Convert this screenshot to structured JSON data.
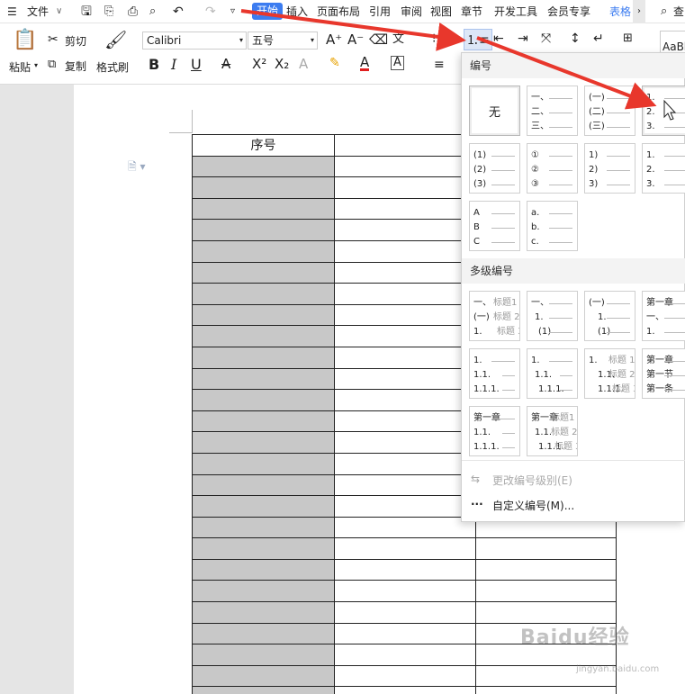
{
  "toolbar": {
    "menu_label": "文件",
    "tabs": [
      "开始",
      "插入",
      "页面布局",
      "引用",
      "审阅",
      "视图",
      "章节",
      "开发工具",
      "会员专享",
      "表格"
    ],
    "active_tab": "开始",
    "search_label": "查"
  },
  "ribbon": {
    "paste": "粘贴",
    "cut": "剪切",
    "copy": "复制",
    "format_painter": "格式刷",
    "font": "Calibri",
    "size": "五号",
    "style_preview": "AaBl"
  },
  "table": {
    "header": "序号",
    "rows": 26
  },
  "dropdown": {
    "section_numbering": "编号",
    "section_multilevel": "多级编号",
    "none_label": "无",
    "change_level": "更改编号级别(E)",
    "custom": "自定义编号(M)...",
    "cards_row1": [
      [
        "一、",
        "二、",
        "三、"
      ],
      [
        "(一)",
        "(二)",
        "(三)"
      ],
      [
        "1.",
        "2.",
        "3."
      ]
    ],
    "cards_row2": [
      [
        "(1)",
        "(2)",
        "(3)"
      ],
      [
        "①",
        "②",
        "③"
      ],
      [
        "1)",
        "2)",
        "3)"
      ],
      [
        "1.",
        "2.",
        "3."
      ]
    ],
    "cards_row3": [
      [
        "A",
        "B",
        "C"
      ],
      [
        "a.",
        "b.",
        "c."
      ]
    ],
    "multi_row1": [
      [
        [
          "一、",
          "标题1"
        ],
        [
          "(一)",
          "标题 2"
        ],
        [
          "1.",
          "标题 3"
        ]
      ],
      [
        [
          "一、",
          ""
        ],
        [
          "1.",
          ""
        ],
        [
          "(1)",
          ""
        ]
      ],
      [
        [
          "(一)",
          ""
        ],
        [
          "1.",
          ""
        ],
        [
          "(1)",
          ""
        ]
      ],
      [
        [
          "第一章",
          ""
        ],
        [
          "一、",
          ""
        ],
        [
          "1.",
          ""
        ]
      ]
    ],
    "multi_row2": [
      [
        [
          "1.",
          ""
        ],
        [
          "1.1.",
          ""
        ],
        [
          "1.1.1.",
          ""
        ]
      ],
      [
        [
          "1.",
          ""
        ],
        [
          "1.1.",
          ""
        ],
        [
          "1.1.1.",
          ""
        ]
      ],
      [
        [
          "1.",
          "标题 1"
        ],
        [
          "1.1.",
          "标题 2"
        ],
        [
          "1.1.1.",
          "标题 3"
        ]
      ],
      [
        [
          "第一章",
          ""
        ],
        [
          "第一节",
          ""
        ],
        [
          "第一条",
          ""
        ]
      ]
    ],
    "multi_row3": [
      [
        [
          "第一章",
          ""
        ],
        [
          "1.1.",
          ""
        ],
        [
          "1.1.1.",
          ""
        ]
      ],
      [
        [
          "第一章",
          "标题1"
        ],
        [
          "1.1.",
          "标题 2"
        ],
        [
          "1.1.1.",
          "标题 3"
        ]
      ]
    ]
  },
  "watermark": {
    "main": "Baidu经验",
    "sub": "jingyan.baidu.com"
  },
  "colors": {
    "accent": "#3c7cf0",
    "arrow": "#e8372c",
    "shade": "#c8c8c8"
  }
}
